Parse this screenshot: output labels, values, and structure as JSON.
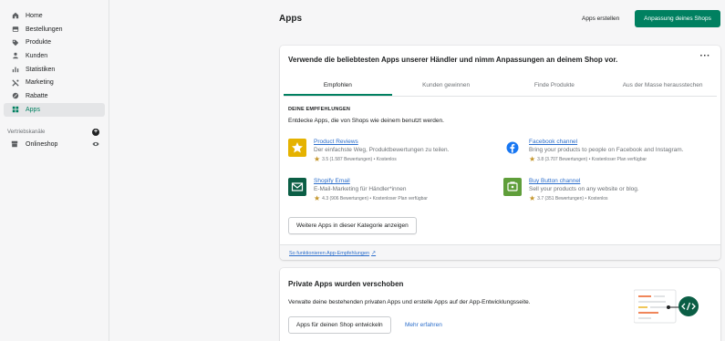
{
  "sidebar": {
    "items": [
      {
        "label": "Home",
        "icon": "home-icon"
      },
      {
        "label": "Bestellungen",
        "icon": "orders-icon"
      },
      {
        "label": "Produkte",
        "icon": "tag-icon"
      },
      {
        "label": "Kunden",
        "icon": "customers-icon"
      },
      {
        "label": "Statistiken",
        "icon": "analytics-icon"
      },
      {
        "label": "Marketing",
        "icon": "marketing-icon"
      },
      {
        "label": "Rabatte",
        "icon": "discount-icon"
      },
      {
        "label": "Apps",
        "icon": "apps-icon",
        "active": true
      }
    ],
    "channels_label": "Vertriebskanäle",
    "onlineshop_label": "Onlineshop"
  },
  "header": {
    "title": "Apps",
    "create_apps": "Apps erstellen",
    "customize_shop": "Anpassung deines Shops"
  },
  "recommend_card": {
    "title": "Verwende die beliebtesten Apps unserer Händler und nimm Anpassungen an deinem Shop vor.",
    "tabs": [
      "Empfohlen",
      "Kunden gewinnen",
      "Finde Produkte",
      "Aus der Masse herausstechen"
    ],
    "section_caption": "DEINE EMPFEHLUNGEN",
    "section_desc": "Entdecke Apps, die von Shops wie deinem benutzt werden.",
    "apps": [
      {
        "name": "Product Reviews",
        "desc": "Der einfachste Weg, Produktbewertungen zu teilen.",
        "rating": "3.5 (1.587 Bewertungen) • Kostenlos",
        "icon": "star-icon",
        "color": "#e5b200"
      },
      {
        "name": "Facebook channel",
        "desc": "Bring your products to people on Facebook and Instagram.",
        "rating": "3.8 (3.707 Bewertungen) • Kostenloser Plan verfügbar",
        "icon": "facebook-icon",
        "color": "#1877f2"
      },
      {
        "name": "Shopify Email",
        "desc": "E-Mail-Marketing für Händler*innen",
        "rating": "4.3 (906 Bewertungen) • Kostenloser Plan verfügbar",
        "icon": "email-icon",
        "color": "#0b5e45"
      },
      {
        "name": "Buy Button channel",
        "desc": "Sell your products on any website or blog.",
        "rating": "3.7 (351 Bewertungen) • Kostenlos",
        "icon": "buy-button-icon",
        "color": "#5f9e3a"
      }
    ],
    "more_button": "Weitere Apps in dieser Kategorie anzeigen",
    "footer_link": "So funktionieren App-Empfehlungen"
  },
  "private_card": {
    "title": "Private Apps wurden verschoben",
    "desc": "Verwalte deine bestehenden privaten Apps und erstelle Apps auf der App-Entwicklungsseite.",
    "button": "Apps für deinen Shop entwickeln",
    "link": "Mehr erfahren"
  }
}
